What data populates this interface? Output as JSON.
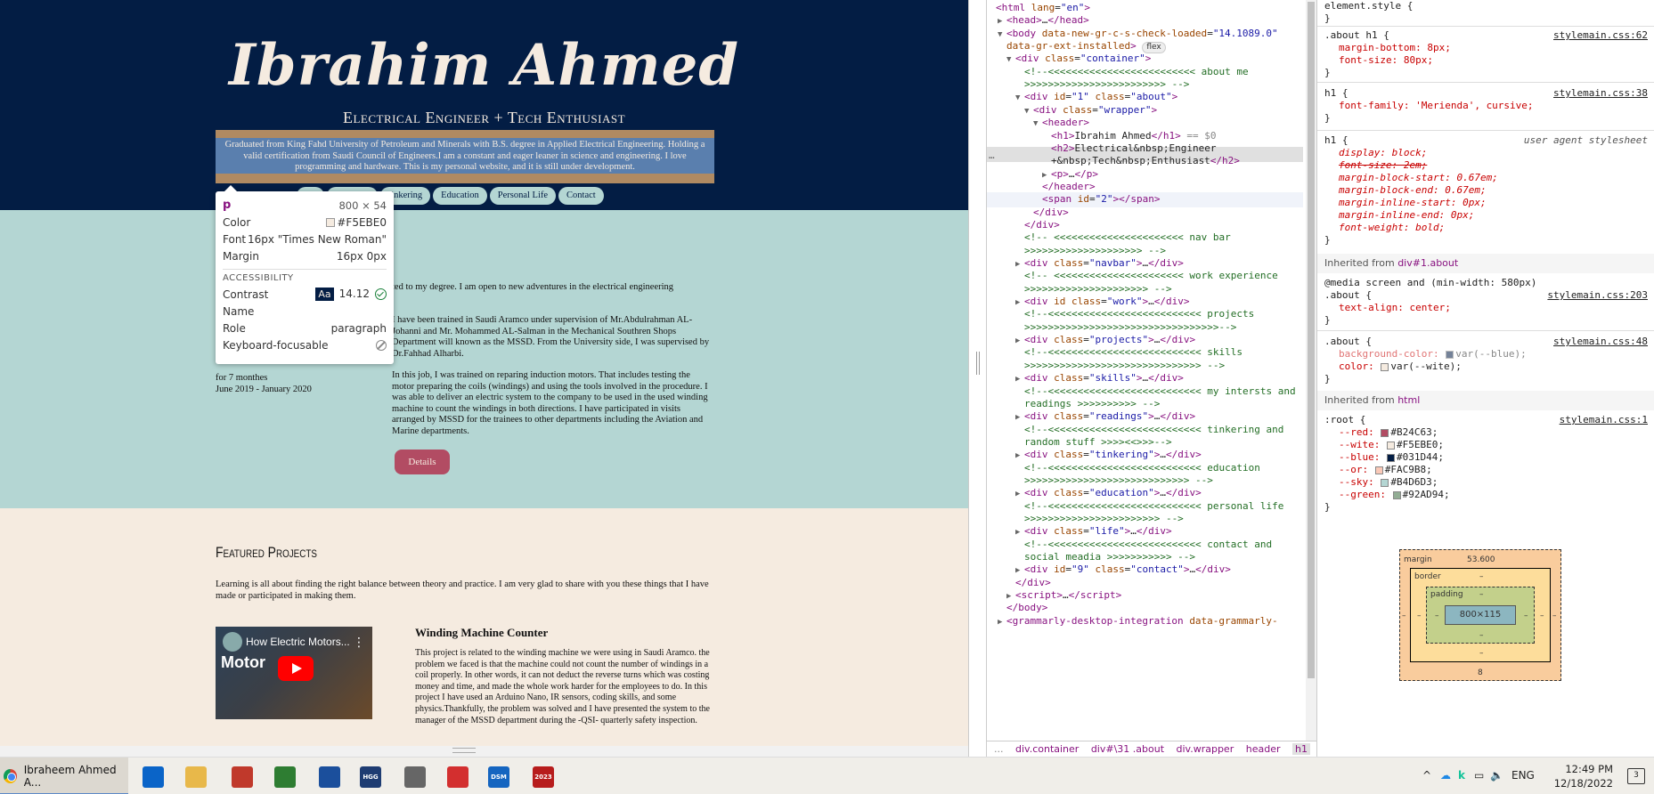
{
  "site": {
    "title": "Ibrahim Ahmed",
    "subtitle": "Electrical Engineer + Tech Enthusiast",
    "intro": "Graduated from King Fahd University of Petroleum and Minerals with B.S. degree in Applied Electrical Engineering. Holding a valid certification from Saudi Council of Engineers.I am a constant and eager leaner in science and engineering. I love programming and hardware. This is my personal website, and it is still under development.",
    "nav": [
      "Skills",
      "Readings",
      "tinkering",
      "Education",
      "Personal Life",
      "Contact"
    ],
    "nav_partial": "ills",
    "work": {
      "p1": "ted to my degree. I am open to new adventures in the electrical engineering",
      "p2": "I have been trained in Saudi Aramco under supervision of Mr.Abdulrahman AL-Johanni and Mr. Mohammed AL-Salman in the Mechanical Southren Shops Department will known as the MSSD. From the University side, I was supervised by Dr.Fahhad Alharbi.",
      "duration": "for 7 monthes",
      "dates": "June 2019 - January 2020",
      "p3": "In this job, I was trained on reparing induction motors. That includes testing the motor preparing the coils (windings) and using the tools involved in the procedure. I was able to deliver an electric system to the company to be used in the used winding machine to count the windings in both directions. I have participated in visits arranged by MSSD for the trainees to other departments including the Aviation and Marine departments.",
      "details_label": "Details"
    },
    "projects": {
      "heading": "Featured Projects",
      "intro": "Learning is all about finding the right balance between theory and practice. I am very glad to share with you these things that I have made or participated in making them.",
      "video_title": "How Electric Motors...",
      "video_word": "Motor",
      "project_title": "Winding Machine Counter",
      "project_desc": "This project is related to the winding machine we were using in Saudi Aramco. the problem we faced is that the machine could not count the number of windings in a coil properly. In other words, it can not deduct the reverse turns which was costing money and time, and made the whole work harder for the employees to do. In this project I have used an Arduino Nano, IR sensors, coding skills, and some physics.Thankfully, the problem was solved and I have presented the system to the manager of the MSSD department during the -QSI- quarterly safety inspection."
    }
  },
  "tooltip": {
    "tag": "p",
    "dimensions": "800 × 54",
    "color_label": "Color",
    "color_value": "#F5EBE0",
    "font_label": "Font",
    "font_value": "16px \"Times New Roman\"",
    "margin_label": "Margin",
    "margin_value": "16px 0px",
    "accessibility_label": "ACCESSIBILITY",
    "contrast_label": "Contrast",
    "contrast_aa": "Aa",
    "contrast_value": "14.12",
    "name_label": "Name",
    "role_label": "Role",
    "role_value": "paragraph",
    "focus_label": "Keyboard-focusable"
  },
  "elements": {
    "lines": [
      {
        "html": "<span class='tag'>&lt;html</span> <span class='attr'>lang</span>=<span class='aval'>\"en\"</span><span class='tag'>&gt;</span>",
        "indent": 10
      },
      {
        "html": "<span class='tri'>▶</span><span class='tag'>&lt;head&gt;</span>…<span class='tag'>&lt;/head&gt;</span>",
        "indent": 12
      },
      {
        "html": "<span class='tri'>▼</span><span class='tag'>&lt;body</span> <span class='attr'>data-new-gr-c-s-check-loaded</span>=<span class='aval'>\"14.1089.0\"</span>",
        "indent": 12
      },
      {
        "html": "<span class='attr'>data-gr-ext-installed</span><span class='tag'>&gt;</span> <span class='badge'>flex</span>",
        "indent": 22
      },
      {
        "html": "<span class='tri'>▼</span><span class='tag'>&lt;div</span> <span class='attr'>class</span>=<span class='aval'>\"container\"</span><span class='tag'>&gt;</span>",
        "indent": 22
      },
      {
        "html": "<span class='cmt'>&lt;!--&lt;&lt;&lt;&lt;&lt;&lt;&lt;&lt;&lt;&lt;&lt;&lt;&lt;&lt;&lt;&lt;&lt;&lt;&lt;&lt;&lt;&lt;&lt;&lt;&lt; about me</span>",
        "indent": 42
      },
      {
        "html": "<span class='cmt'>&gt;&gt;&gt;&gt;&gt;&gt;&gt;&gt;&gt;&gt;&gt;&gt;&gt;&gt;&gt;&gt;&gt;&gt;&gt;&gt;&gt;&gt;&gt;&gt;  --&gt;</span>",
        "indent": 42
      },
      {
        "html": "<span class='tri'>▼</span><span class='tag'>&lt;div</span> <span class='attr'>id</span>=<span class='aval'>\"1\"</span> <span class='attr'>class</span>=<span class='aval'>\"about\"</span><span class='tag'>&gt;</span>",
        "indent": 32
      },
      {
        "html": "<span class='tri'>▼</span><span class='tag'>&lt;div</span> <span class='attr'>class</span>=<span class='aval'>\"wrapper\"</span><span class='tag'>&gt;</span>",
        "indent": 42
      },
      {
        "html": "<span class='tri'>▼</span><span class='tag'>&lt;header&gt;</span>",
        "indent": 52
      },
      {
        "html": "<span class='tag'>&lt;h1&gt;</span><span class='txt'>Ibrahim Ahmed</span><span class='tag'>&lt;/h1&gt;</span> <span class='dim'>== $0</span>",
        "indent": 72
      },
      {
        "html": "<span class='tag'>&lt;h2&gt;</span><span class='txt'>Electrical&amp;nbsp;Engineer</span>",
        "indent": 72
      },
      {
        "html": "<span class='txt'>+&amp;nbsp;Tech&amp;nbsp;Enthusiast</span><span class='tag'>&lt;/h2&gt;</span>",
        "indent": 72
      },
      {
        "html": "<span class='tri'>▶</span><span class='tag'>&lt;p&gt;</span>…<span class='tag'>&lt;/p&gt;</span>",
        "indent": 62
      },
      {
        "html": "<span class='tag'>&lt;/header&gt;</span>",
        "indent": 62
      },
      {
        "html": "<span class='tag'>&lt;span</span> <span class='attr'>id</span>=<span class='aval'>\"2\"</span><span class='tag'>&gt;&lt;/span&gt;</span>",
        "indent": 62
      },
      {
        "html": "<span class='tag'>&lt;/div&gt;</span>",
        "indent": 52
      },
      {
        "html": "<span class='tag'>&lt;/div&gt;</span>",
        "indent": 42
      },
      {
        "html": "<span class='cmt'>&lt;!-- &lt;&lt;&lt;&lt;&lt;&lt;&lt;&lt;&lt;&lt;&lt;&lt;&lt;&lt;&lt;&lt;&lt;&lt;&lt;&lt;&lt;&lt; nav bar</span>",
        "indent": 42
      },
      {
        "html": "<span class='cmt'>&gt;&gt;&gt;&gt;&gt;&gt;&gt;&gt;&gt;&gt;&gt;&gt;&gt;&gt;&gt;&gt;&gt;&gt;&gt;&gt; --&gt;</span>",
        "indent": 42
      },
      {
        "html": "<span class='tri'>▶</span><span class='tag'>&lt;div</span> <span class='attr'>class</span>=<span class='aval'>\"navbar\"</span><span class='tag'>&gt;</span>…<span class='tag'>&lt;/div&gt;</span>",
        "indent": 32
      },
      {
        "html": "<span class='cmt'>&lt;!-- &lt;&lt;&lt;&lt;&lt;&lt;&lt;&lt;&lt;&lt;&lt;&lt;&lt;&lt;&lt;&lt;&lt;&lt;&lt;&lt;&lt;&lt; work experience</span>",
        "indent": 42
      },
      {
        "html": "<span class='cmt'>&gt;&gt;&gt;&gt;&gt;&gt;&gt;&gt;&gt;&gt;&gt;&gt;&gt;&gt;&gt;&gt;&gt;&gt;&gt;&gt;&gt; --&gt;</span>",
        "indent": 42
      },
      {
        "html": "<span class='tri'>▶</span><span class='tag'>&lt;div</span> <span class='attr'>id</span> <span class='attr'>class</span>=<span class='aval'>\"work\"</span><span class='tag'>&gt;</span>…<span class='tag'>&lt;/div&gt;</span>",
        "indent": 32
      },
      {
        "html": "<span class='cmt'>&lt;!--&lt;&lt;&lt;&lt;&lt;&lt;&lt;&lt;&lt;&lt;&lt;&lt;&lt;&lt;&lt;&lt;&lt;&lt;&lt;&lt;&lt;&lt;&lt;&lt;&lt;&lt; projects</span>",
        "indent": 42
      },
      {
        "html": "<span class='cmt'>&gt;&gt;&gt;&gt;&gt;&gt;&gt;&gt;&gt;&gt;&gt;&gt;&gt;&gt;&gt;&gt;&gt;&gt;&gt;&gt;&gt;&gt;&gt;&gt;&gt;&gt;&gt;&gt;&gt;&gt;&gt;&gt;&gt;--&gt;</span>",
        "indent": 42
      },
      {
        "html": "<span class='tri'>▶</span><span class='tag'>&lt;div</span> <span class='attr'>class</span>=<span class='aval'>\"projects\"</span><span class='tag'>&gt;</span>…<span class='tag'>&lt;/div&gt;</span>",
        "indent": 32
      },
      {
        "html": "<span class='cmt'>&lt;!--&lt;&lt;&lt;&lt;&lt;&lt;&lt;&lt;&lt;&lt;&lt;&lt;&lt;&lt;&lt;&lt;&lt;&lt;&lt;&lt;&lt;&lt;&lt;&lt;&lt;&lt; skills</span>",
        "indent": 42
      },
      {
        "html": "<span class='cmt'>&gt;&gt;&gt;&gt;&gt;&gt;&gt;&gt;&gt;&gt;&gt;&gt;&gt;&gt;&gt;&gt;&gt;&gt;&gt;&gt;&gt;&gt;&gt;&gt;&gt;&gt;&gt;&gt;&gt;&gt; --&gt;</span>",
        "indent": 42
      },
      {
        "html": "<span class='tri'>▶</span><span class='tag'>&lt;div</span> <span class='attr'>class</span>=<span class='aval'>\"skills\"</span><span class='tag'>&gt;</span>…<span class='tag'>&lt;/div&gt;</span>",
        "indent": 32
      },
      {
        "html": "<span class='cmt'>&lt;!--&lt;&lt;&lt;&lt;&lt;&lt;&lt;&lt;&lt;&lt;&lt;&lt;&lt;&lt;&lt;&lt;&lt;&lt;&lt;&lt;&lt;&lt;&lt;&lt;&lt;&lt; my intersts and</span>",
        "indent": 42
      },
      {
        "html": "<span class='cmt'>readings  &gt;&gt;&gt;&gt;&gt;&gt;&gt;&gt;&gt;&gt;  --&gt;</span>",
        "indent": 42
      },
      {
        "html": "<span class='tri'>▶</span><span class='tag'>&lt;div</span> <span class='attr'>class</span>=<span class='aval'>\"readings\"</span><span class='tag'>&gt;</span>…<span class='tag'>&lt;/div&gt;</span>",
        "indent": 32
      },
      {
        "html": "<span class='cmt'>&lt;!--&lt;&lt;&lt;&lt;&lt;&lt;&lt;&lt;&lt;&lt;&lt;&lt;&lt;&lt;&lt;&lt;&lt;&lt;&lt;&lt;&lt;&lt;&lt;&lt;&lt;&lt; tinkering and</span>",
        "indent": 42
      },
      {
        "html": "<span class='cmt'>random stuff &gt;&gt;&gt;&gt;&lt;&lt;&gt;&gt;&gt;--&gt;</span>",
        "indent": 42
      },
      {
        "html": "<span class='tri'>▶</span><span class='tag'>&lt;div</span> <span class='attr'>class</span>=<span class='aval'>\"tinkering\"</span><span class='tag'>&gt;</span>…<span class='tag'>&lt;/div&gt;</span>",
        "indent": 32
      },
      {
        "html": "<span class='cmt'>&lt;!--&lt;&lt;&lt;&lt;&lt;&lt;&lt;&lt;&lt;&lt;&lt;&lt;&lt;&lt;&lt;&lt;&lt;&lt;&lt;&lt;&lt;&lt;&lt;&lt;&lt;&lt; education</span>",
        "indent": 42
      },
      {
        "html": "<span class='cmt'>&gt;&gt;&gt;&gt;&gt;&gt;&gt;&gt;&gt;&gt;&gt;&gt;&gt;&gt;&gt;&gt;&gt;&gt;&gt;&gt;&gt;&gt;&gt;&gt;&gt;&gt;&gt;&gt; --&gt;</span>",
        "indent": 42
      },
      {
        "html": "<span class='tri'>▶</span><span class='tag'>&lt;div</span> <span class='attr'>class</span>=<span class='aval'>\"education\"</span><span class='tag'>&gt;</span>…<span class='tag'>&lt;/div&gt;</span>",
        "indent": 32
      },
      {
        "html": "<span class='cmt'>&lt;!--&lt;&lt;&lt;&lt;&lt;&lt;&lt;&lt;&lt;&lt;&lt;&lt;&lt;&lt;&lt;&lt;&lt;&lt;&lt;&lt;&lt;&lt;&lt;&lt;&lt;&lt; personal life</span>",
        "indent": 42
      },
      {
        "html": "<span class='cmt'>&gt;&gt;&gt;&gt;&gt;&gt;&gt;&gt;&gt;&gt;&gt;&gt;&gt;&gt;&gt;&gt;&gt;&gt;&gt;&gt;&gt;&gt;&gt; --&gt;</span>",
        "indent": 42
      },
      {
        "html": "<span class='tri'>▶</span><span class='tag'>&lt;div</span> <span class='attr'>class</span>=<span class='aval'>\"life\"</span><span class='tag'>&gt;</span>…<span class='tag'>&lt;/div&gt;</span>",
        "indent": 32
      },
      {
        "html": "<span class='cmt'>&lt;!--&lt;&lt;&lt;&lt;&lt;&lt;&lt;&lt;&lt;&lt;&lt;&lt;&lt;&lt;&lt;&lt;&lt;&lt;&lt;&lt;&lt;&lt;&lt;&lt;&lt;&lt; contact and</span>",
        "indent": 42
      },
      {
        "html": "<span class='cmt'>social meadia &gt;&gt;&gt;&gt;&gt;&gt;&gt;&gt;&gt;&gt;&gt; --&gt;</span>",
        "indent": 42
      },
      {
        "html": "<span class='tri'>▶</span><span class='tag'>&lt;div</span> <span class='attr'>id</span>=<span class='aval'>\"9\"</span> <span class='attr'>class</span>=<span class='aval'>\"contact\"</span><span class='tag'>&gt;</span>…<span class='tag'>&lt;/div&gt;</span>",
        "indent": 32
      },
      {
        "html": "<span class='tag'>&lt;/div&gt;</span>",
        "indent": 32
      },
      {
        "html": "<span class='tri'>▶</span><span class='tag'>&lt;script&gt;</span>…<span class='tag'>&lt;/script&gt;</span>",
        "indent": 22
      },
      {
        "html": "<span class='tag'>&lt;/body&gt;</span>",
        "indent": 22
      },
      {
        "html": "<span class='tri'>▶</span><span class='tag'>&lt;grammarly-desktop-integration</span> <span class='attr'>data-grammarly-</span>",
        "indent": 12
      }
    ],
    "breadcrumb": [
      "...",
      "div.container",
      "div#\\31 .about",
      "div.wrapper",
      "header",
      "h1",
      "..."
    ]
  },
  "styles": {
    "element_style": "element.style {",
    "about_h1_sel": ".about h1 {",
    "about_h1_src": "stylemain.css:62",
    "about_h1_p1": "margin-bottom: 8px;",
    "about_h1_p2": "font-size: 80px;",
    "h1_sel": "h1 {",
    "h1_src": "stylemain.css:38",
    "h1_p1": "font-family: 'Merienda', cursive;",
    "ua_sel": "h1 {",
    "ua_src": "user agent stylesheet",
    "ua_props": [
      "display: block;",
      "font-size: 2em;",
      "margin-block-start: 0.67em;",
      "margin-block-end: 0.67em;",
      "margin-inline-start: 0px;",
      "margin-inline-end: 0px;",
      "font-weight: bold;"
    ],
    "inherit1_prefix": "Inherited from ",
    "inherit1_link": "div#1.about",
    "media_line": "@media screen and (min-width: 580px)",
    "about_media_sel": ".about {",
    "about_media_src": "stylemain.css:203",
    "about_media_p1": "text-align: center;",
    "about_sel": ".about {",
    "about_src": "stylemain.css:48",
    "about_p1": "background-color:",
    "about_p1_val": "var(--blue);",
    "about_p2": "color:",
    "about_p2_val": "var(--wite);",
    "inherit2_prefix": "Inherited from ",
    "inherit2_link": "html",
    "root_sel": ":root {",
    "root_src": "stylemain.css:1",
    "root_vars": [
      {
        "name": "--red:",
        "value": "#B24C63",
        "color": "#B24C63"
      },
      {
        "name": "--wite:",
        "value": "#F5EBE0",
        "color": "#F5EBE0"
      },
      {
        "name": "--blue:",
        "value": "#031D44",
        "color": "#031D44"
      },
      {
        "name": "--or:",
        "value": "#FAC9B8",
        "color": "#FAC9B8"
      },
      {
        "name": "--sky:",
        "value": "#B4D6D3",
        "color": "#B4D6D3"
      },
      {
        "name": "--green:",
        "value": "#92AD94",
        "color": "#92AD94"
      }
    ],
    "boxmodel": {
      "margin_label": "margin",
      "margin_top": "53.600",
      "margin_bottom": "8",
      "border_label": "border",
      "padding_label": "padding",
      "content": "800×115",
      "dash": "–"
    }
  },
  "taskbar": {
    "active_app": "Ibraheem Ahmed A...",
    "apps": [
      {
        "label": "",
        "color": "#0a64c8"
      },
      {
        "label": "",
        "color": "#e8b84a"
      },
      {
        "label": "",
        "color": "#c0392b"
      },
      {
        "label": "",
        "color": "#2e7d32"
      },
      {
        "label": "",
        "color": "#1b4f9c"
      },
      {
        "label": "HGG",
        "color": "#1e3c72"
      },
      {
        "label": "",
        "color": "#666"
      },
      {
        "label": "",
        "color": "#d32f2f"
      },
      {
        "label": "DSM",
        "color": "#1565c0"
      },
      {
        "label": "2023",
        "color": "#b71c1c"
      }
    ],
    "lang": "ENG",
    "time": "12:49 PM",
    "date": "12/18/2022",
    "notif_count": "3"
  },
  "colors": {
    "blue": "#031D44",
    "wite": "#F5EBE0",
    "sky": "#B4D6D3",
    "red": "#B24C63"
  }
}
